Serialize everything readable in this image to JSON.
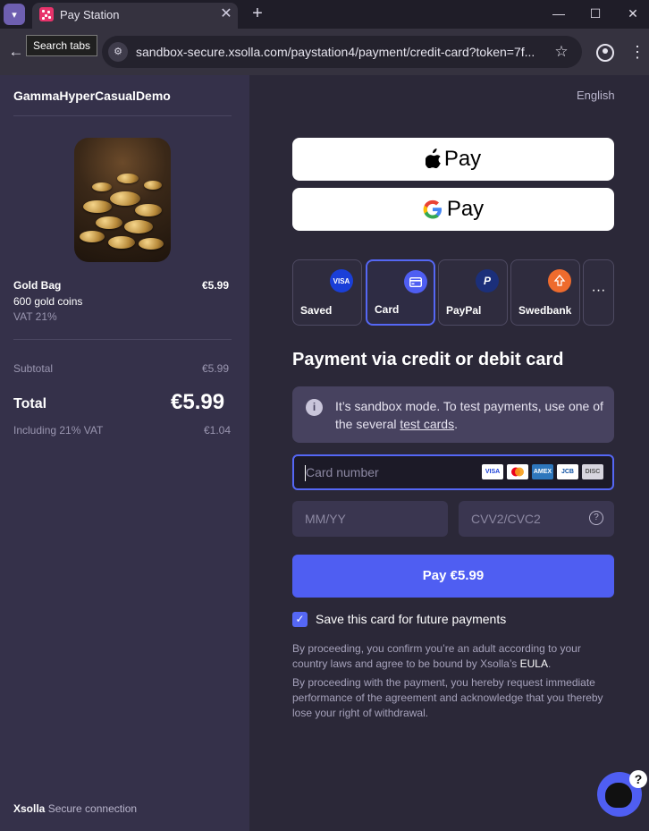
{
  "browser": {
    "tab_title": "Pay Station",
    "tooltip": "Search tabs",
    "url": "sandbox-secure.xsolla.com/paystation4/payment/credit-card?token=7f..."
  },
  "sidebar": {
    "merchant": "GammaHyperCasualDemo",
    "item_name": "Gold Bag",
    "item_price": "€5.99",
    "item_desc": "600 gold coins",
    "item_vat": "VAT 21%",
    "subtotal_label": "Subtotal",
    "subtotal_value": "€5.99",
    "total_label": "Total",
    "total_value": "€5.99",
    "incl_vat_label": "Including 21% VAT",
    "incl_vat_value": "€1.04",
    "secure_brand": "Xsolla",
    "secure_text": "Secure connection"
  },
  "main": {
    "language": "English",
    "apple_pay_label": "Pay",
    "google_pay_label": "Pay",
    "methods": [
      {
        "label": "Saved",
        "icon": "VISA",
        "color": "#1a3fd8"
      },
      {
        "label": "Card",
        "icon": "card-icon",
        "color": "#4f5ef2"
      },
      {
        "label": "PayPal",
        "icon": "P",
        "color": "#1b2f7a"
      },
      {
        "label": "Swedbank",
        "icon": "tree-icon",
        "color": "#ee6b2d"
      }
    ],
    "more_label": "···",
    "section_title": "Payment via credit or debit card",
    "info_text_1": "It’s sandbox mode. To test payments, use one of the several ",
    "info_link": "test cards",
    "info_text_2": ".",
    "card_placeholder": "Card number",
    "card_brands": [
      "VISA",
      "MC",
      "AMEX",
      "JCB",
      "DISC"
    ],
    "expiry_placeholder": "MM/YY",
    "cvv_placeholder": "CVV2/CVC2",
    "pay_button": "Pay €5.99",
    "save_card_label": "Save this card for future payments",
    "legal_1a": "By proceeding, you confirm you’re an adult according to your country laws and agree to be bound by Xsolla’s ",
    "legal_1_link": "EULA",
    "legal_1b": ".",
    "legal_2": "By proceeding with the payment, you hereby request immediate performance of the agreement and acknowledge that you thereby lose your right of withdrawal."
  },
  "colors": {
    "accent": "#4f5ef2",
    "sidebar_bg": "#35314a",
    "main_bg": "#2b2838"
  }
}
